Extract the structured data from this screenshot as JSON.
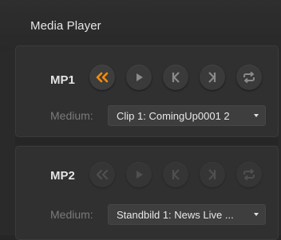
{
  "panel": {
    "title": "Media Player"
  },
  "players": [
    {
      "label": "MP1",
      "medium_label": "Medium:",
      "medium_value": "Clip 1: ComingUp0001 2",
      "enabled": true
    },
    {
      "label": "MP2",
      "medium_label": "Medium:",
      "medium_value": "Standbild 1: News Live ...",
      "enabled": false
    }
  ],
  "icons": [
    "rewind-icon",
    "play-icon",
    "previous-frame-icon",
    "next-frame-icon",
    "loop-icon",
    "dropdown-caret-icon"
  ],
  "colors": {
    "accent": "#ff8c00",
    "background": "#262626",
    "text": "#e4e4e4",
    "muted": "#7a7a7a"
  }
}
